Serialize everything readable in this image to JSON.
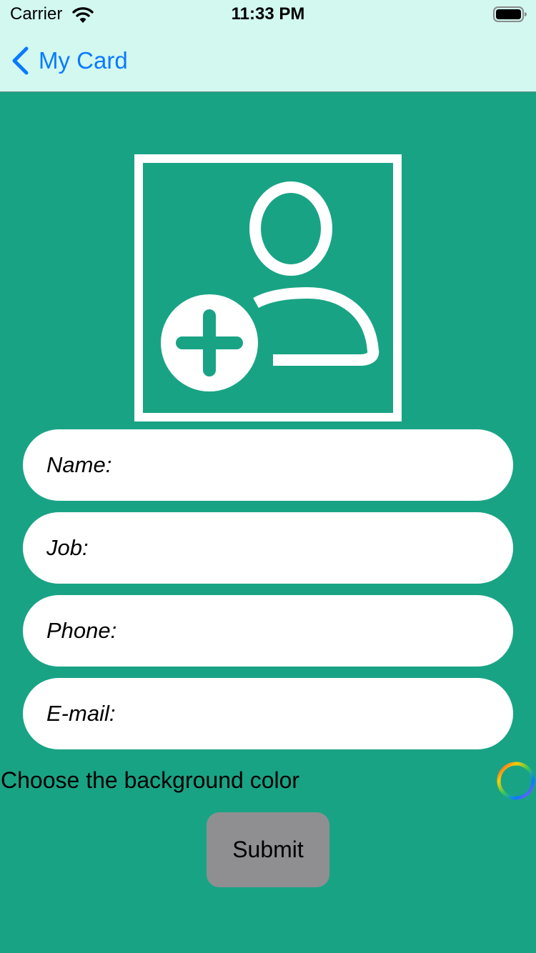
{
  "status_bar": {
    "carrier": "Carrier",
    "time": "11:33 PM",
    "wifi_icon": "wifi-icon",
    "battery_icon": "battery-icon"
  },
  "nav": {
    "back_label": "My Card",
    "back_icon": "chevron-left-icon"
  },
  "avatar": {
    "icon": "add-person-icon"
  },
  "form": {
    "name_placeholder": "Name:",
    "job_placeholder": "Job:",
    "phone_placeholder": "Phone:",
    "email_placeholder": "E-mail:"
  },
  "color_picker": {
    "label": "Choose the background color",
    "icon": "color-wheel-icon"
  },
  "submit_label": "Submit",
  "colors": {
    "nav_background": "#d2f8f0",
    "page_background": "#19a385",
    "accent": "#0a7aff",
    "submit_background": "#8f8f92"
  }
}
